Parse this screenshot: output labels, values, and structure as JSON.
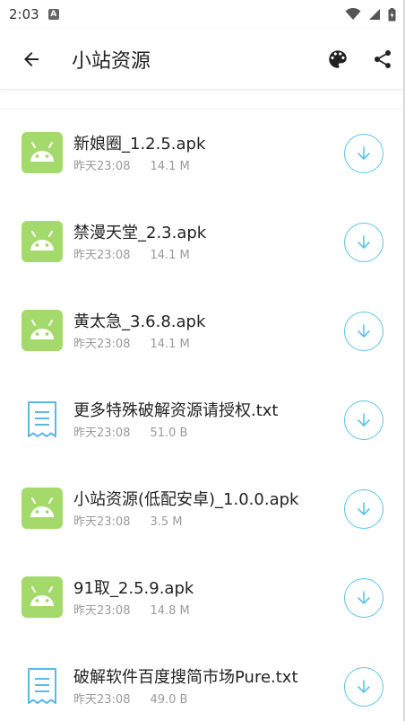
{
  "status_bar": {
    "time": "2:03",
    "notification_badge": "A"
  },
  "app_bar": {
    "title": "小站资源"
  },
  "colors": {
    "android_green": "#a4d96c",
    "text_doc_blue": "#5db7e8",
    "download_blue": "#5ec2ea"
  },
  "files": [
    {
      "name": "新娘圈_1.2.5.apk",
      "time": "昨天23:08",
      "size": "14.1 M",
      "icon": "android-icon"
    },
    {
      "name": "禁漫天堂_2.3.apk",
      "time": "昨天23:08",
      "size": "14.1 M",
      "icon": "android-icon"
    },
    {
      "name": "黄太急_3.6.8.apk",
      "time": "昨天23:08",
      "size": "14.1 M",
      "icon": "android-icon"
    },
    {
      "name": "更多特殊破解资源请授权.txt",
      "time": "昨天23:08",
      "size": "51.0 B",
      "icon": "text-file-icon"
    },
    {
      "name": "小站资源(低配安卓)_1.0.0.apk",
      "time": "昨天23:08",
      "size": "3.5 M",
      "icon": "android-icon"
    },
    {
      "name": "91取_2.5.9.apk",
      "time": "昨天23:08",
      "size": "14.8 M",
      "icon": "android-icon"
    },
    {
      "name": "破解软件百度搜简市场Pure.txt",
      "time": "昨天23:08",
      "size": "49.0 B",
      "icon": "text-file-icon"
    }
  ]
}
